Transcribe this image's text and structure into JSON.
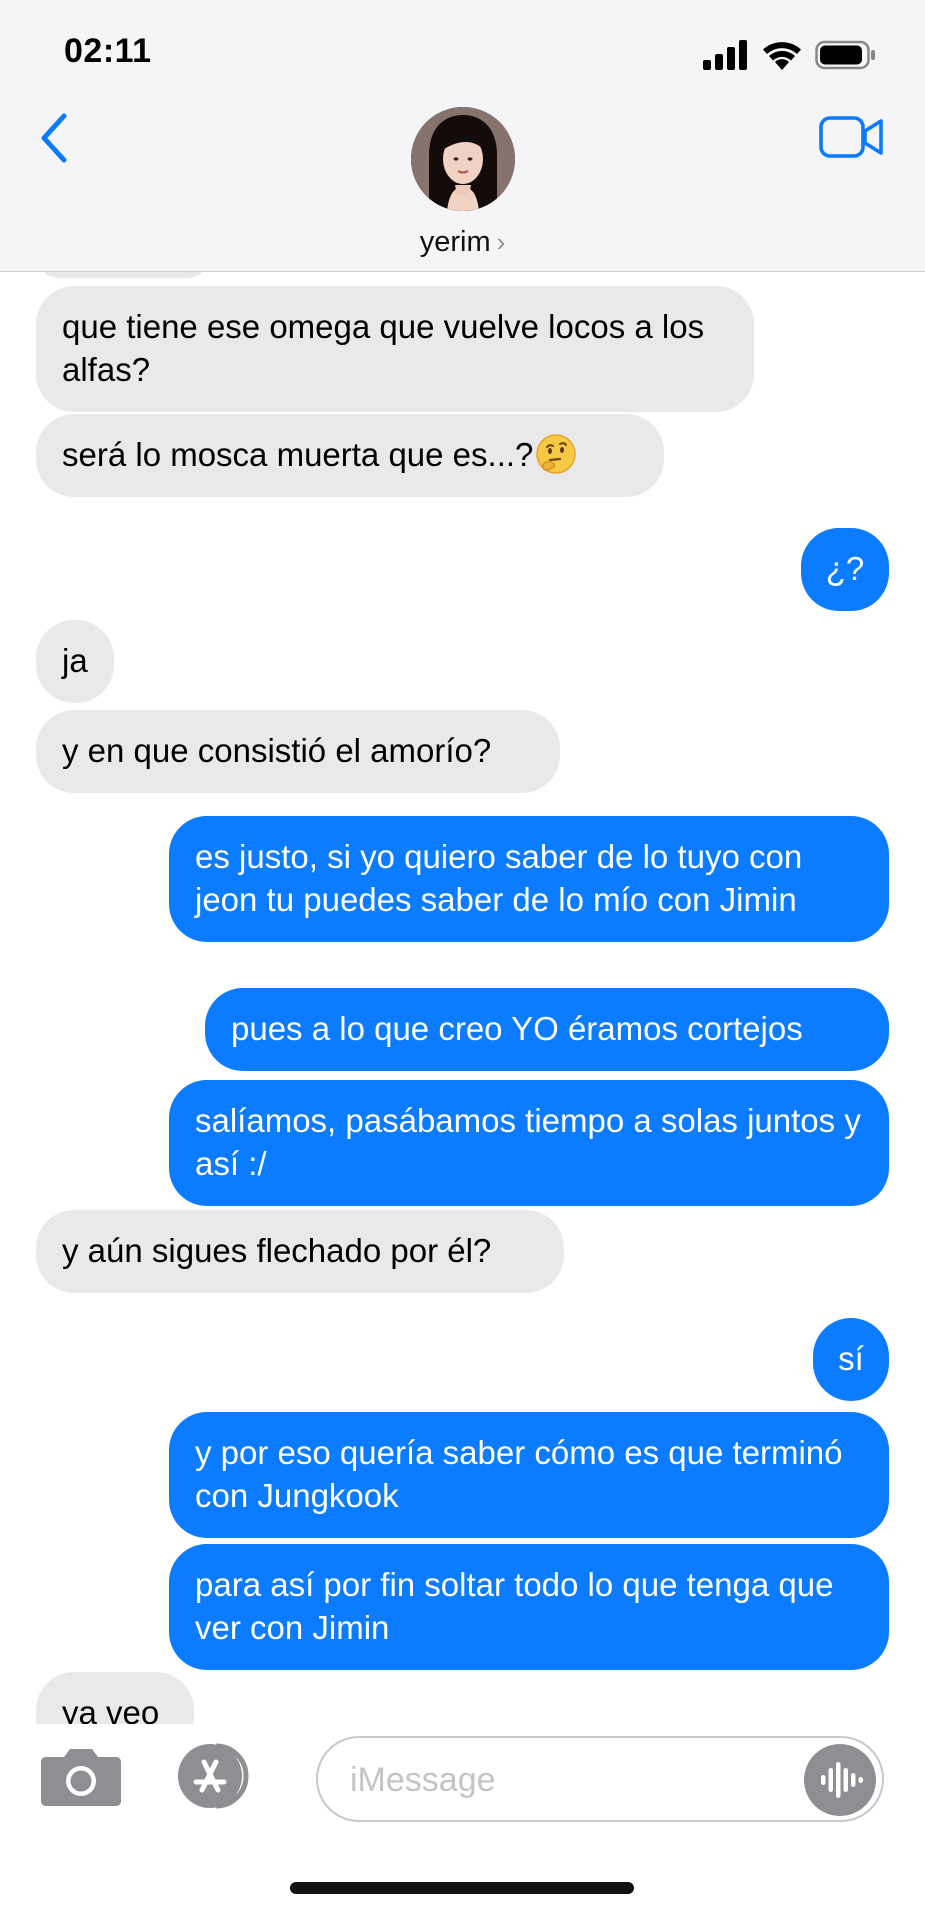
{
  "status_bar": {
    "time": "02:11"
  },
  "header": {
    "contact_name": "yerim",
    "name_chevron": "›"
  },
  "messages": [
    {
      "direction": "in",
      "text": "que tiene ese omega que vuelve locos a los alfas?"
    },
    {
      "direction": "in",
      "text": "será lo mosca muerta que es...?",
      "emoji": "thinking-face"
    },
    {
      "direction": "out",
      "text": "¿?"
    },
    {
      "direction": "in",
      "text": "ja"
    },
    {
      "direction": "in",
      "text": "y en que consistió el amorío?"
    },
    {
      "direction": "out",
      "text": "es justo, si yo quiero saber de lo tuyo con jeon tu puedes saber de lo mío con Jimin"
    },
    {
      "direction": "out",
      "text": "pues a lo que creo YO éramos cortejos"
    },
    {
      "direction": "out",
      "text": "salíamos, pasábamos tiempo a solas juntos y así :/"
    },
    {
      "direction": "in",
      "text": "y aún sigues flechado por él?"
    },
    {
      "direction": "out",
      "text": "sí"
    },
    {
      "direction": "out",
      "text": "y por eso quería saber cómo es que terminó con Jungkook"
    },
    {
      "direction": "out",
      "text": "para así por fin soltar todo lo que tenga que ver con Jimin"
    },
    {
      "direction": "in",
      "text": "ya veo"
    }
  ],
  "input_bar": {
    "placeholder": "iMessage"
  },
  "colors": {
    "sent_bubble": "#0b7cff",
    "received_bubble": "#e9e9eb",
    "accent": "#0a7aff"
  }
}
